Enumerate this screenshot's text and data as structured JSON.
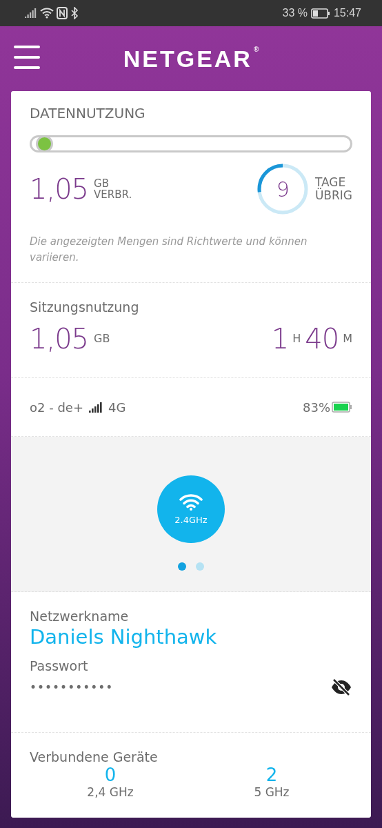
{
  "status_bar": {
    "battery": "33 %",
    "time": "15:47"
  },
  "header": {
    "logo": "NETGEAR",
    "registered": "®"
  },
  "data_usage": {
    "title": "DATENNUTZUNG",
    "level": 0.02,
    "used_value": "1,05",
    "used_unit": "GB",
    "used_label": "VERBR.",
    "days_value": "9",
    "days_label_1": "TAGE",
    "days_label_2": "ÜBRIG",
    "note": "Die angezeigten Mengen sind Richtwerte und können variieren."
  },
  "session": {
    "title": "Sitzungsnutzung",
    "data_value": "1,05",
    "data_unit": "GB",
    "hours": "1",
    "hours_unit": "H",
    "minutes": "40",
    "minutes_unit": "M"
  },
  "connection": {
    "carrier": "o2 - de+",
    "network": "4G",
    "battery": "83%"
  },
  "bands": {
    "band": "2.4GHz",
    "pages": [
      {
        "selected": true
      },
      {
        "selected": false
      }
    ]
  },
  "network": {
    "name_label": "Netzwerkname",
    "name": "Daniels Nighthawk",
    "password_label": "Passwort",
    "password": "•••••••••••",
    "password_visible": false
  },
  "devices": {
    "title": "Verbundene Geräte",
    "items": [
      {
        "count": "0",
        "band": "2,4 GHz"
      },
      {
        "count": "2",
        "band": "5 GHz"
      }
    ]
  }
}
